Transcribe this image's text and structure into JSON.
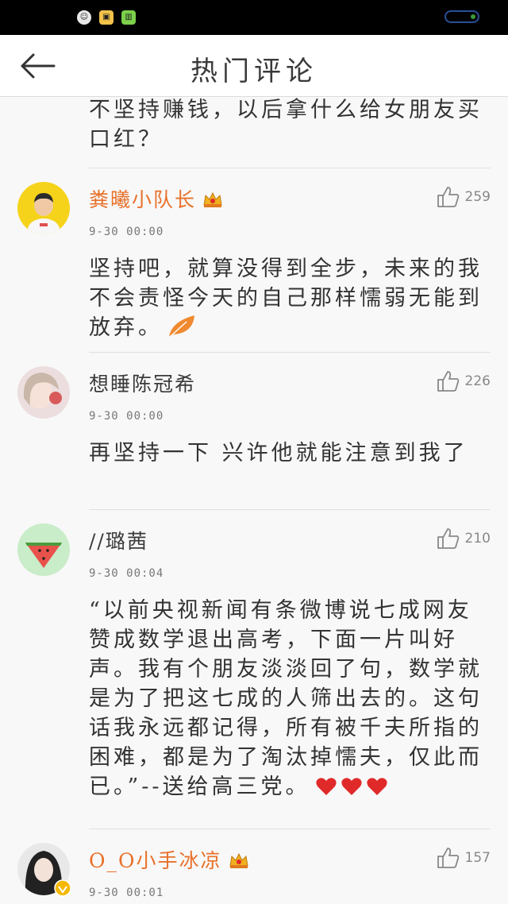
{
  "app_bar": {
    "title": "热门评论",
    "back_icon": "arrow-left-icon"
  },
  "colors": {
    "vip_name": "#e8712a",
    "status_bar": "#000000",
    "badge_gold": "#f0b020",
    "heart": "#e02a2a",
    "leaf": "#f08a30"
  },
  "partial_comment": {
    "text": "不坚持赚钱，以后拿什么给女朋友买口红？"
  },
  "comments": [
    {
      "username": "粪曦小队长",
      "vip": true,
      "likes": "259",
      "time": "9-30 00:00",
      "text": "坚持吧，就算没得到全步，未来的我不会责怪今天的自己那样懦弱无能到放弃。"
    },
    {
      "username": "想睡陈冠希",
      "vip": false,
      "likes": "226",
      "time": "9-30 00:00",
      "text": "再坚持一下 兴许他就能注意到我了"
    },
    {
      "username": "//璐茜",
      "vip": false,
      "likes": "210",
      "time": "9-30 00:04",
      "text": "“以前央视新闻有条微博说七成网友赞成数学退出高考，下面一片叫好声。我有个朋友淡淡回了句，数学就是为了把这七成的人筛出去的。这句话我永远都记得，所有被千夫所指的困难，都是为了淘汰掉懦夫，仅此而已。”--送给高三党。"
    },
    {
      "username": "O_O小手冰凉",
      "vip": true,
      "likes": "157",
      "time": "9-30 00:01",
      "text": ""
    }
  ]
}
